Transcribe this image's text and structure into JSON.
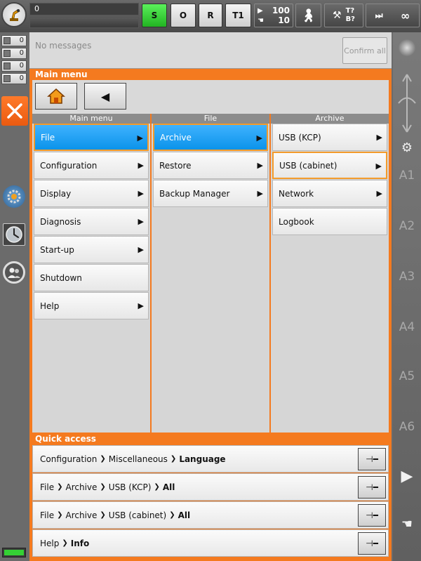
{
  "topbar": {
    "program_number": "0",
    "buttons": {
      "submit": "S",
      "robot_interpreter": "O",
      "drives": "R",
      "mode": "T1"
    },
    "override": {
      "program_override": "100",
      "jog_override": "10"
    },
    "tool_base": {
      "tool": "T?",
      "base": "B?"
    },
    "increment": "∞"
  },
  "left_counters": [
    {
      "name": "acknowledge-messages",
      "value": "0"
    },
    {
      "name": "status-messages",
      "value": "0"
    },
    {
      "name": "dialog-messages",
      "value": "0"
    },
    {
      "name": "notification-messages",
      "value": "0"
    }
  ],
  "messages": {
    "text": "No messages",
    "confirm_all": "Confirm all"
  },
  "main_menu": {
    "title": "Main menu",
    "columns": [
      {
        "header": "Main menu",
        "items": [
          {
            "label": "File",
            "arrow": true,
            "selected": true
          },
          {
            "label": "Configuration",
            "arrow": true
          },
          {
            "label": "Display",
            "arrow": true
          },
          {
            "label": "Diagnosis",
            "arrow": true
          },
          {
            "label": "Start-up",
            "arrow": true
          },
          {
            "label": "Shutdown",
            "arrow": false
          },
          {
            "label": "Help",
            "arrow": true
          }
        ]
      },
      {
        "header": "File",
        "items": [
          {
            "label": "Archive",
            "arrow": true,
            "selected": true
          },
          {
            "label": "Restore",
            "arrow": true
          },
          {
            "label": "Backup Manager",
            "arrow": true
          }
        ]
      },
      {
        "header": "Archive",
        "items": [
          {
            "label": "USB (KCP)",
            "arrow": true
          },
          {
            "label": "USB (cabinet)",
            "arrow": true,
            "highlighted": true
          },
          {
            "label": "Network",
            "arrow": true
          },
          {
            "label": "Logbook",
            "arrow": false
          }
        ]
      }
    ]
  },
  "quick_access": {
    "title": "Quick access",
    "rows": [
      {
        "path": [
          "Configuration",
          "Miscellaneous"
        ],
        "last": "Language"
      },
      {
        "path": [
          "File",
          "Archive",
          "USB (KCP)"
        ],
        "last": "All"
      },
      {
        "path": [
          "File",
          "Archive",
          "USB (cabinet)"
        ],
        "last": "All"
      },
      {
        "path": [
          "Help"
        ],
        "last": "Info"
      }
    ]
  },
  "axes": [
    "A1",
    "A2",
    "A3",
    "A4",
    "A5",
    "A6"
  ],
  "colors": {
    "accent_orange": "#f47a1f",
    "selected_blue": "#0b93ea",
    "submit_green": "#2ec42e"
  }
}
